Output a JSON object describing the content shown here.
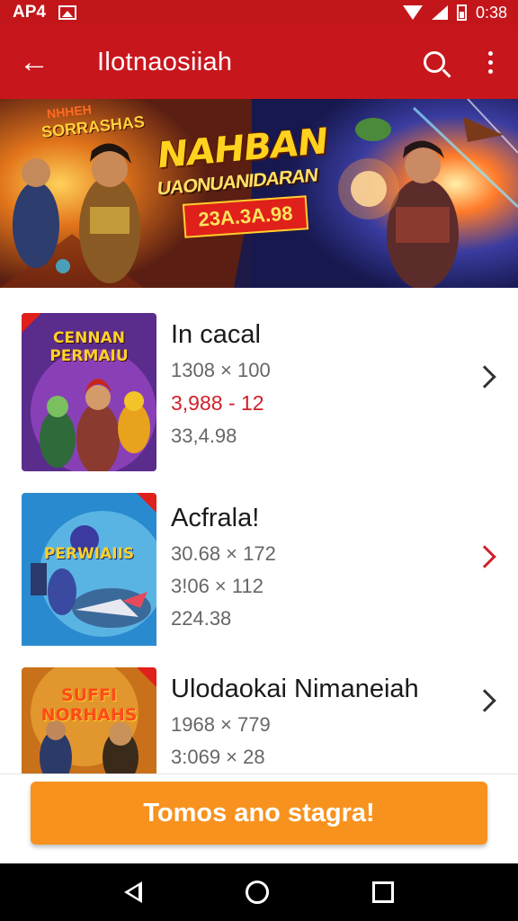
{
  "status_bar": {
    "left_text": "AP4",
    "time": "0:38"
  },
  "app_bar": {
    "title": "Ilotnaosiiah"
  },
  "banner": {
    "tag_top": "NHHEH",
    "tag": "SORRASHAS",
    "headline": "NAHBAN",
    "subhead": "UAONUANIDARAN",
    "date_pill": "23A.3A.98"
  },
  "list": {
    "items": [
      {
        "title": "In cacal",
        "line1": "1308 × 100",
        "price": "3,988 - 12",
        "line3": "33,4.98",
        "thumb_text": "CENNAN PERMAIU",
        "chevron_color": "#333333"
      },
      {
        "title": "Acfrala!",
        "line1": "30.68 × 172",
        "price": "3!06 × 112",
        "line3": "224.38",
        "thumb_text": "PERWIAIIS",
        "chevron_color": "#d0202a"
      },
      {
        "title": "Ulodaokai Nimaneiah",
        "line1": "1968 × 779",
        "price": "3:069 × 28",
        "line3": "",
        "thumb_text": "SUFFI NORHAHS",
        "chevron_color": "#333333"
      }
    ]
  },
  "cta": {
    "label": "Tomos ano stagra!"
  },
  "colors": {
    "primary": "#c8161d",
    "accent": "#f7921e",
    "price": "#d0202a"
  }
}
